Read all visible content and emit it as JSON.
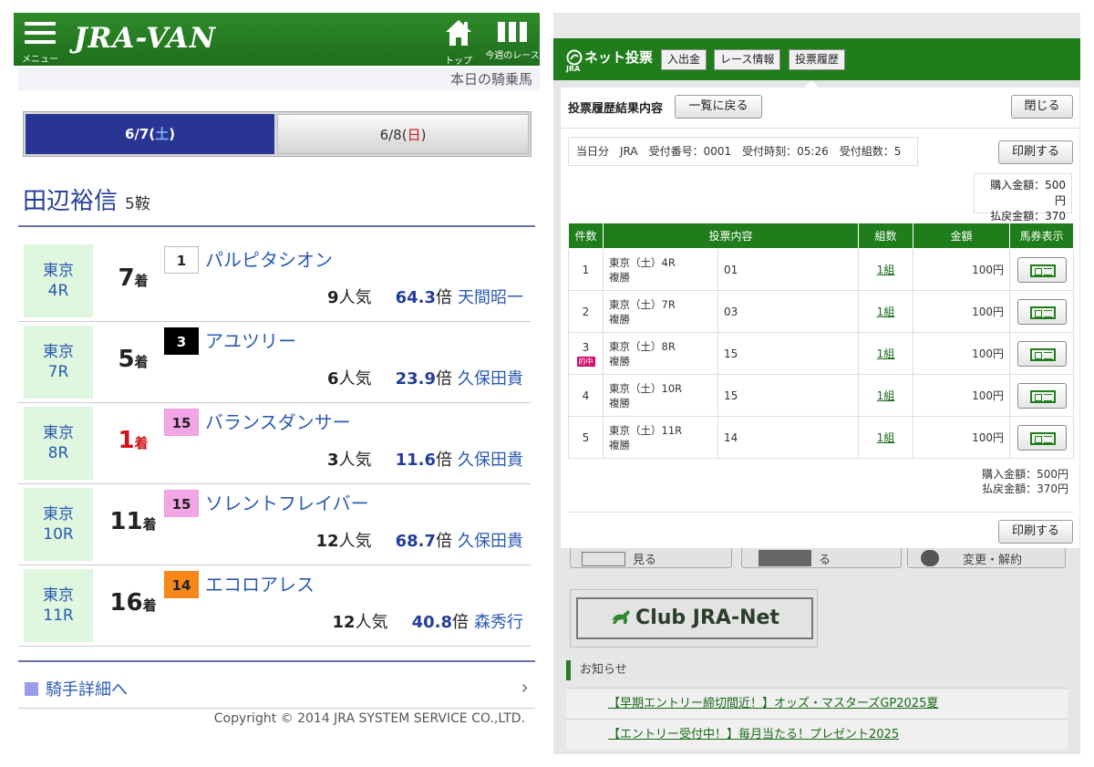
{
  "left": {
    "header": {
      "menu_label": "メニュー",
      "logo": "JRA-VAN",
      "top_label": "トップ",
      "week_label": "今週のレース"
    },
    "subbar": "本日の騎乗馬",
    "date_tabs": [
      {
        "pre": "6/7(",
        "day": "土",
        "post": ")"
      },
      {
        "pre": "6/8(",
        "day": "日",
        "post": ")"
      }
    ],
    "jockey": {
      "name": "田辺裕信",
      "rides": "5鞍"
    },
    "rides": [
      {
        "venue": "東京",
        "race": "4R",
        "finish": "7",
        "finish_suffix": "着",
        "horse_no": "1",
        "horse": "パルピタシオン",
        "pop": "9",
        "pop_suffix": "人気",
        "odds": "64.3",
        "odds_suffix": "倍",
        "jockey": "天間昭一"
      },
      {
        "venue": "東京",
        "race": "7R",
        "finish": "5",
        "finish_suffix": "着",
        "horse_no": "3",
        "horse": "アユツリー",
        "pop": "6",
        "pop_suffix": "人気",
        "odds": "23.9",
        "odds_suffix": "倍",
        "jockey": "久保田貴"
      },
      {
        "venue": "東京",
        "race": "8R",
        "finish": "1",
        "finish_suffix": "着",
        "horse_no": "15",
        "horse": "バランスダンサー",
        "pop": "3",
        "pop_suffix": "人気",
        "odds": "11.6",
        "odds_suffix": "倍",
        "jockey": "久保田貴"
      },
      {
        "venue": "東京",
        "race": "10R",
        "finish": "11",
        "finish_suffix": "着",
        "horse_no": "15",
        "horse": "ソレントフレイバー",
        "pop": "12",
        "pop_suffix": "人気",
        "odds": "68.7",
        "odds_suffix": "倍",
        "jockey": "久保田貴"
      },
      {
        "venue": "東京",
        "race": "11R",
        "finish": "16",
        "finish_suffix": "着",
        "horse_no": "14",
        "horse": "エコロアレス",
        "pop": "12",
        "pop_suffix": "人気",
        "odds": "40.8",
        "odds_suffix": "倍",
        "jockey": "森秀行"
      }
    ],
    "detail_link": "騎手詳細へ",
    "copyright": "Copyright © 2014 JRA SYSTEM SERVICE CO.,LTD."
  },
  "colors": {
    "header_green": "#1f6e1c",
    "tab_selected": "#283593",
    "win_red": "#d0121b",
    "gate_1": "#ffffff",
    "gate_2": "#000000",
    "gate_7": "#f2a6e6",
    "gate_8": "#f7861b",
    "hit_badge": "#d10f6c"
  },
  "right": {
    "header": {
      "logo": "ネット投票",
      "logo_sub": "JRA",
      "nav": [
        "入出金",
        "レース情報",
        "投票履歴"
      ]
    },
    "modal": {
      "title": "投票履歴結果内容",
      "back_button": "一覧に戻る",
      "close_button": "閉じる",
      "info": "当日分　JRA　受付番号：0001　受付時刻：05:26　受付組数：5",
      "print_button": "印刷する",
      "purchase": "購入金額：500円",
      "payout": "払戻金額：370円",
      "columns": [
        "件数",
        "投票内容",
        "組数",
        "金額",
        "馬券表示"
      ],
      "rows": [
        {
          "no": "1",
          "race": "東京（土）4R",
          "type": "複勝",
          "sel": "01",
          "count": "1組",
          "amount": "100円",
          "hit": ""
        },
        {
          "no": "2",
          "race": "東京（土）7R",
          "type": "複勝",
          "sel": "03",
          "count": "1組",
          "amount": "100円",
          "hit": ""
        },
        {
          "no": "3",
          "race": "東京（土）8R",
          "type": "複勝",
          "sel": "15",
          "count": "1組",
          "amount": "100円",
          "hit": "的中"
        },
        {
          "no": "4",
          "race": "東京（土）10R",
          "type": "複勝",
          "sel": "15",
          "count": "1組",
          "amount": "100円",
          "hit": ""
        },
        {
          "no": "5",
          "race": "東京（土）11R",
          "type": "複勝",
          "sel": "14",
          "count": "1組",
          "amount": "100円",
          "hit": ""
        }
      ]
    },
    "background": {
      "buttons": [
        "見る",
        "る",
        "変更・解約"
      ],
      "club": "Club JRA-Net",
      "notice_heading": "お知らせ",
      "notices": [
        "【早期エントリー締切間近！】オッズ・マスターズGP2025夏",
        "【エントリー受付中！】毎月当たる！プレゼント2025"
      ]
    }
  }
}
